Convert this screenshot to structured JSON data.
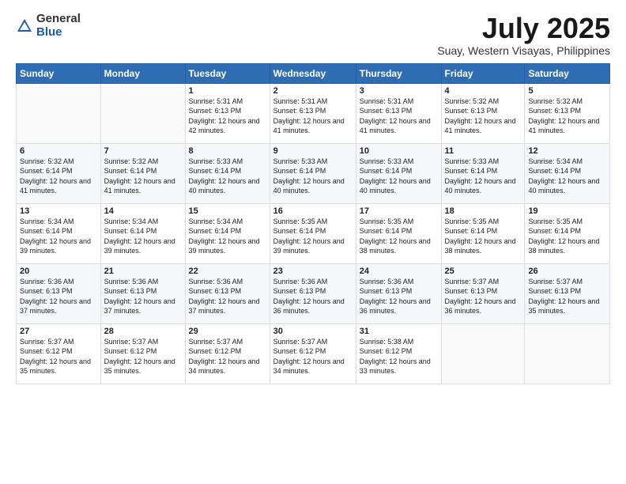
{
  "logo": {
    "general": "General",
    "blue": "Blue"
  },
  "header": {
    "title": "July 2025",
    "subtitle": "Suay, Western Visayas, Philippines"
  },
  "days_of_week": [
    "Sunday",
    "Monday",
    "Tuesday",
    "Wednesday",
    "Thursday",
    "Friday",
    "Saturday"
  ],
  "weeks": [
    [
      {
        "day": "",
        "sunrise": "",
        "sunset": "",
        "daylight": ""
      },
      {
        "day": "",
        "sunrise": "",
        "sunset": "",
        "daylight": ""
      },
      {
        "day": "1",
        "sunrise": "Sunrise: 5:31 AM",
        "sunset": "Sunset: 6:13 PM",
        "daylight": "Daylight: 12 hours and 42 minutes."
      },
      {
        "day": "2",
        "sunrise": "Sunrise: 5:31 AM",
        "sunset": "Sunset: 6:13 PM",
        "daylight": "Daylight: 12 hours and 41 minutes."
      },
      {
        "day": "3",
        "sunrise": "Sunrise: 5:31 AM",
        "sunset": "Sunset: 6:13 PM",
        "daylight": "Daylight: 12 hours and 41 minutes."
      },
      {
        "day": "4",
        "sunrise": "Sunrise: 5:32 AM",
        "sunset": "Sunset: 6:13 PM",
        "daylight": "Daylight: 12 hours and 41 minutes."
      },
      {
        "day": "5",
        "sunrise": "Sunrise: 5:32 AM",
        "sunset": "Sunset: 6:13 PM",
        "daylight": "Daylight: 12 hours and 41 minutes."
      }
    ],
    [
      {
        "day": "6",
        "sunrise": "Sunrise: 5:32 AM",
        "sunset": "Sunset: 6:14 PM",
        "daylight": "Daylight: 12 hours and 41 minutes."
      },
      {
        "day": "7",
        "sunrise": "Sunrise: 5:32 AM",
        "sunset": "Sunset: 6:14 PM",
        "daylight": "Daylight: 12 hours and 41 minutes."
      },
      {
        "day": "8",
        "sunrise": "Sunrise: 5:33 AM",
        "sunset": "Sunset: 6:14 PM",
        "daylight": "Daylight: 12 hours and 40 minutes."
      },
      {
        "day": "9",
        "sunrise": "Sunrise: 5:33 AM",
        "sunset": "Sunset: 6:14 PM",
        "daylight": "Daylight: 12 hours and 40 minutes."
      },
      {
        "day": "10",
        "sunrise": "Sunrise: 5:33 AM",
        "sunset": "Sunset: 6:14 PM",
        "daylight": "Daylight: 12 hours and 40 minutes."
      },
      {
        "day": "11",
        "sunrise": "Sunrise: 5:33 AM",
        "sunset": "Sunset: 6:14 PM",
        "daylight": "Daylight: 12 hours and 40 minutes."
      },
      {
        "day": "12",
        "sunrise": "Sunrise: 5:34 AM",
        "sunset": "Sunset: 6:14 PM",
        "daylight": "Daylight: 12 hours and 40 minutes."
      }
    ],
    [
      {
        "day": "13",
        "sunrise": "Sunrise: 5:34 AM",
        "sunset": "Sunset: 6:14 PM",
        "daylight": "Daylight: 12 hours and 39 minutes."
      },
      {
        "day": "14",
        "sunrise": "Sunrise: 5:34 AM",
        "sunset": "Sunset: 6:14 PM",
        "daylight": "Daylight: 12 hours and 39 minutes."
      },
      {
        "day": "15",
        "sunrise": "Sunrise: 5:34 AM",
        "sunset": "Sunset: 6:14 PM",
        "daylight": "Daylight: 12 hours and 39 minutes."
      },
      {
        "day": "16",
        "sunrise": "Sunrise: 5:35 AM",
        "sunset": "Sunset: 6:14 PM",
        "daylight": "Daylight: 12 hours and 39 minutes."
      },
      {
        "day": "17",
        "sunrise": "Sunrise: 5:35 AM",
        "sunset": "Sunset: 6:14 PM",
        "daylight": "Daylight: 12 hours and 38 minutes."
      },
      {
        "day": "18",
        "sunrise": "Sunrise: 5:35 AM",
        "sunset": "Sunset: 6:14 PM",
        "daylight": "Daylight: 12 hours and 38 minutes."
      },
      {
        "day": "19",
        "sunrise": "Sunrise: 5:35 AM",
        "sunset": "Sunset: 6:14 PM",
        "daylight": "Daylight: 12 hours and 38 minutes."
      }
    ],
    [
      {
        "day": "20",
        "sunrise": "Sunrise: 5:36 AM",
        "sunset": "Sunset: 6:13 PM",
        "daylight": "Daylight: 12 hours and 37 minutes."
      },
      {
        "day": "21",
        "sunrise": "Sunrise: 5:36 AM",
        "sunset": "Sunset: 6:13 PM",
        "daylight": "Daylight: 12 hours and 37 minutes."
      },
      {
        "day": "22",
        "sunrise": "Sunrise: 5:36 AM",
        "sunset": "Sunset: 6:13 PM",
        "daylight": "Daylight: 12 hours and 37 minutes."
      },
      {
        "day": "23",
        "sunrise": "Sunrise: 5:36 AM",
        "sunset": "Sunset: 6:13 PM",
        "daylight": "Daylight: 12 hours and 36 minutes."
      },
      {
        "day": "24",
        "sunrise": "Sunrise: 5:36 AM",
        "sunset": "Sunset: 6:13 PM",
        "daylight": "Daylight: 12 hours and 36 minutes."
      },
      {
        "day": "25",
        "sunrise": "Sunrise: 5:37 AM",
        "sunset": "Sunset: 6:13 PM",
        "daylight": "Daylight: 12 hours and 36 minutes."
      },
      {
        "day": "26",
        "sunrise": "Sunrise: 5:37 AM",
        "sunset": "Sunset: 6:13 PM",
        "daylight": "Daylight: 12 hours and 35 minutes."
      }
    ],
    [
      {
        "day": "27",
        "sunrise": "Sunrise: 5:37 AM",
        "sunset": "Sunset: 6:12 PM",
        "daylight": "Daylight: 12 hours and 35 minutes."
      },
      {
        "day": "28",
        "sunrise": "Sunrise: 5:37 AM",
        "sunset": "Sunset: 6:12 PM",
        "daylight": "Daylight: 12 hours and 35 minutes."
      },
      {
        "day": "29",
        "sunrise": "Sunrise: 5:37 AM",
        "sunset": "Sunset: 6:12 PM",
        "daylight": "Daylight: 12 hours and 34 minutes."
      },
      {
        "day": "30",
        "sunrise": "Sunrise: 5:37 AM",
        "sunset": "Sunset: 6:12 PM",
        "daylight": "Daylight: 12 hours and 34 minutes."
      },
      {
        "day": "31",
        "sunrise": "Sunrise: 5:38 AM",
        "sunset": "Sunset: 6:12 PM",
        "daylight": "Daylight: 12 hours and 33 minutes."
      },
      {
        "day": "",
        "sunrise": "",
        "sunset": "",
        "daylight": ""
      },
      {
        "day": "",
        "sunrise": "",
        "sunset": "",
        "daylight": ""
      }
    ]
  ]
}
